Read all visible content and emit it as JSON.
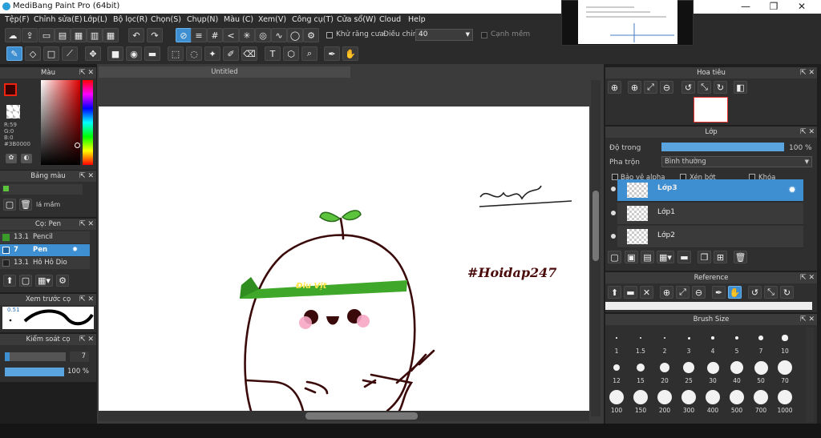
{
  "window": {
    "title": "MediBang Paint Pro (64bit)",
    "min": "—",
    "max": "❐",
    "close": "✕"
  },
  "menu": [
    "Tệp(F)",
    "Chỉnh sửa(E)",
    "Lớp(L)",
    "Bộ lọc(R)",
    "Chọn(S)",
    "Chụp(N)",
    "Màu (C)",
    "Xem(V)",
    "Công cụ(T)",
    "Cửa sổ(W)",
    "Cloud",
    "Help"
  ],
  "toolbar1": {
    "antialias_label": "Khử răng cưa",
    "correction_label": "Điều chỉnh",
    "correction_value": "40",
    "edge_label": "Cạnh mềm"
  },
  "canvas_tab": "Untitled",
  "color_panel": {
    "title": "Màu",
    "r": "R:59",
    "g": "G:0",
    "b": "B:0",
    "hex": "#3B0000"
  },
  "palette_panel": {
    "title": "Bảng màu",
    "item": "lá mầm"
  },
  "brush_panel": {
    "title": "Cọ: Pen",
    "brushes": [
      {
        "size": "13.1",
        "name": "Pencil",
        "color": "#3a9a2a"
      },
      {
        "size": "7",
        "name": "Pen",
        "color": "#3d8fd1"
      },
      {
        "size": "13.1",
        "name": "Hô Hô Dio",
        "color": "#222222"
      }
    ]
  },
  "stroke_preview": {
    "title": "Xem trước cọ",
    "size": "0.51"
  },
  "brush_control": {
    "title": "Kiểm soát cọ",
    "size": "7",
    "opacity": "100 %"
  },
  "navigator": {
    "title": "Hoa tiêu"
  },
  "layer_panel": {
    "title": "Lớp",
    "opacity_label": "Độ trong",
    "opacity_value": "100 %",
    "blend_label": "Pha trộn",
    "blend_value": "Bình thường",
    "protect_alpha": "Bảo vệ alpha",
    "clip": "Xén bớt",
    "lock": "Khóa",
    "layers": [
      "Lớp3",
      "Lớp1",
      "Lớp2"
    ]
  },
  "reference_panel": {
    "title": "Reference"
  },
  "brush_size_panel": {
    "title": "Brush Size",
    "sizes": [
      "1",
      "1.5",
      "2",
      "3",
      "4",
      "5",
      "7",
      "10",
      "12",
      "15",
      "20",
      "25",
      "30",
      "40",
      "50",
      "70",
      "100",
      "150",
      "200",
      "300",
      "400",
      "500",
      "700",
      "1000"
    ]
  },
  "canvas_text": {
    "headband": "Điu Vịt",
    "tag": "#Hoidap247",
    "signature": "ntyd2"
  },
  "colors": {
    "accent": "#3d8fd1",
    "current": "#3B0000",
    "sprout": "#5cc43c"
  }
}
